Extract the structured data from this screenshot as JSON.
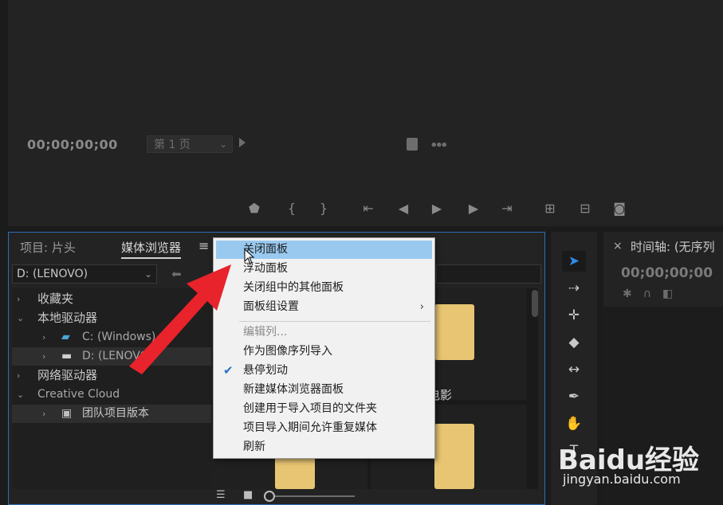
{
  "monitor": {
    "timecode": "00;00;00;00",
    "page_label": "第 1 页"
  },
  "media_panel": {
    "tabs": [
      {
        "label": "项目: 片头"
      },
      {
        "label": "媒体浏览器"
      }
    ],
    "menu_glyph": "≡",
    "drive_value": "D: (LENOVO)",
    "tree": [
      {
        "label": "收藏夹"
      },
      {
        "label": "本地驱动器"
      },
      {
        "label": "C: (Windows)"
      },
      {
        "label": "D: (LENOVO)"
      },
      {
        "label": "网络驱动器"
      },
      {
        "label": "Creative Cloud"
      },
      {
        "label": "团队项目版本"
      }
    ],
    "thumb_label": "电影"
  },
  "timeline": {
    "title": "时间轴: (无序列",
    "timecode": "00;00;00;00"
  },
  "context_menu": {
    "items": [
      {
        "label": "关闭面板"
      },
      {
        "label": "浮动面板"
      },
      {
        "label": "关闭组中的其他面板"
      },
      {
        "label": "面板组设置"
      },
      {
        "label": "编辑列..."
      },
      {
        "label": "作为图像序列导入"
      },
      {
        "label": "悬停划动"
      },
      {
        "label": "新建媒体浏览器面板"
      },
      {
        "label": "创建用于导入项目的文件夹"
      },
      {
        "label": "项目导入期间允许重复媒体"
      },
      {
        "label": "刷新"
      }
    ]
  },
  "watermark": {
    "logo": "Baidu经验",
    "url": "jingyan.baidu.com"
  },
  "colors": {
    "accent_blue": "#2f8ce8",
    "menu_highlight": "#99c9ef",
    "arrow_red": "#e8232b",
    "folder_yellow": "#e7c573"
  }
}
